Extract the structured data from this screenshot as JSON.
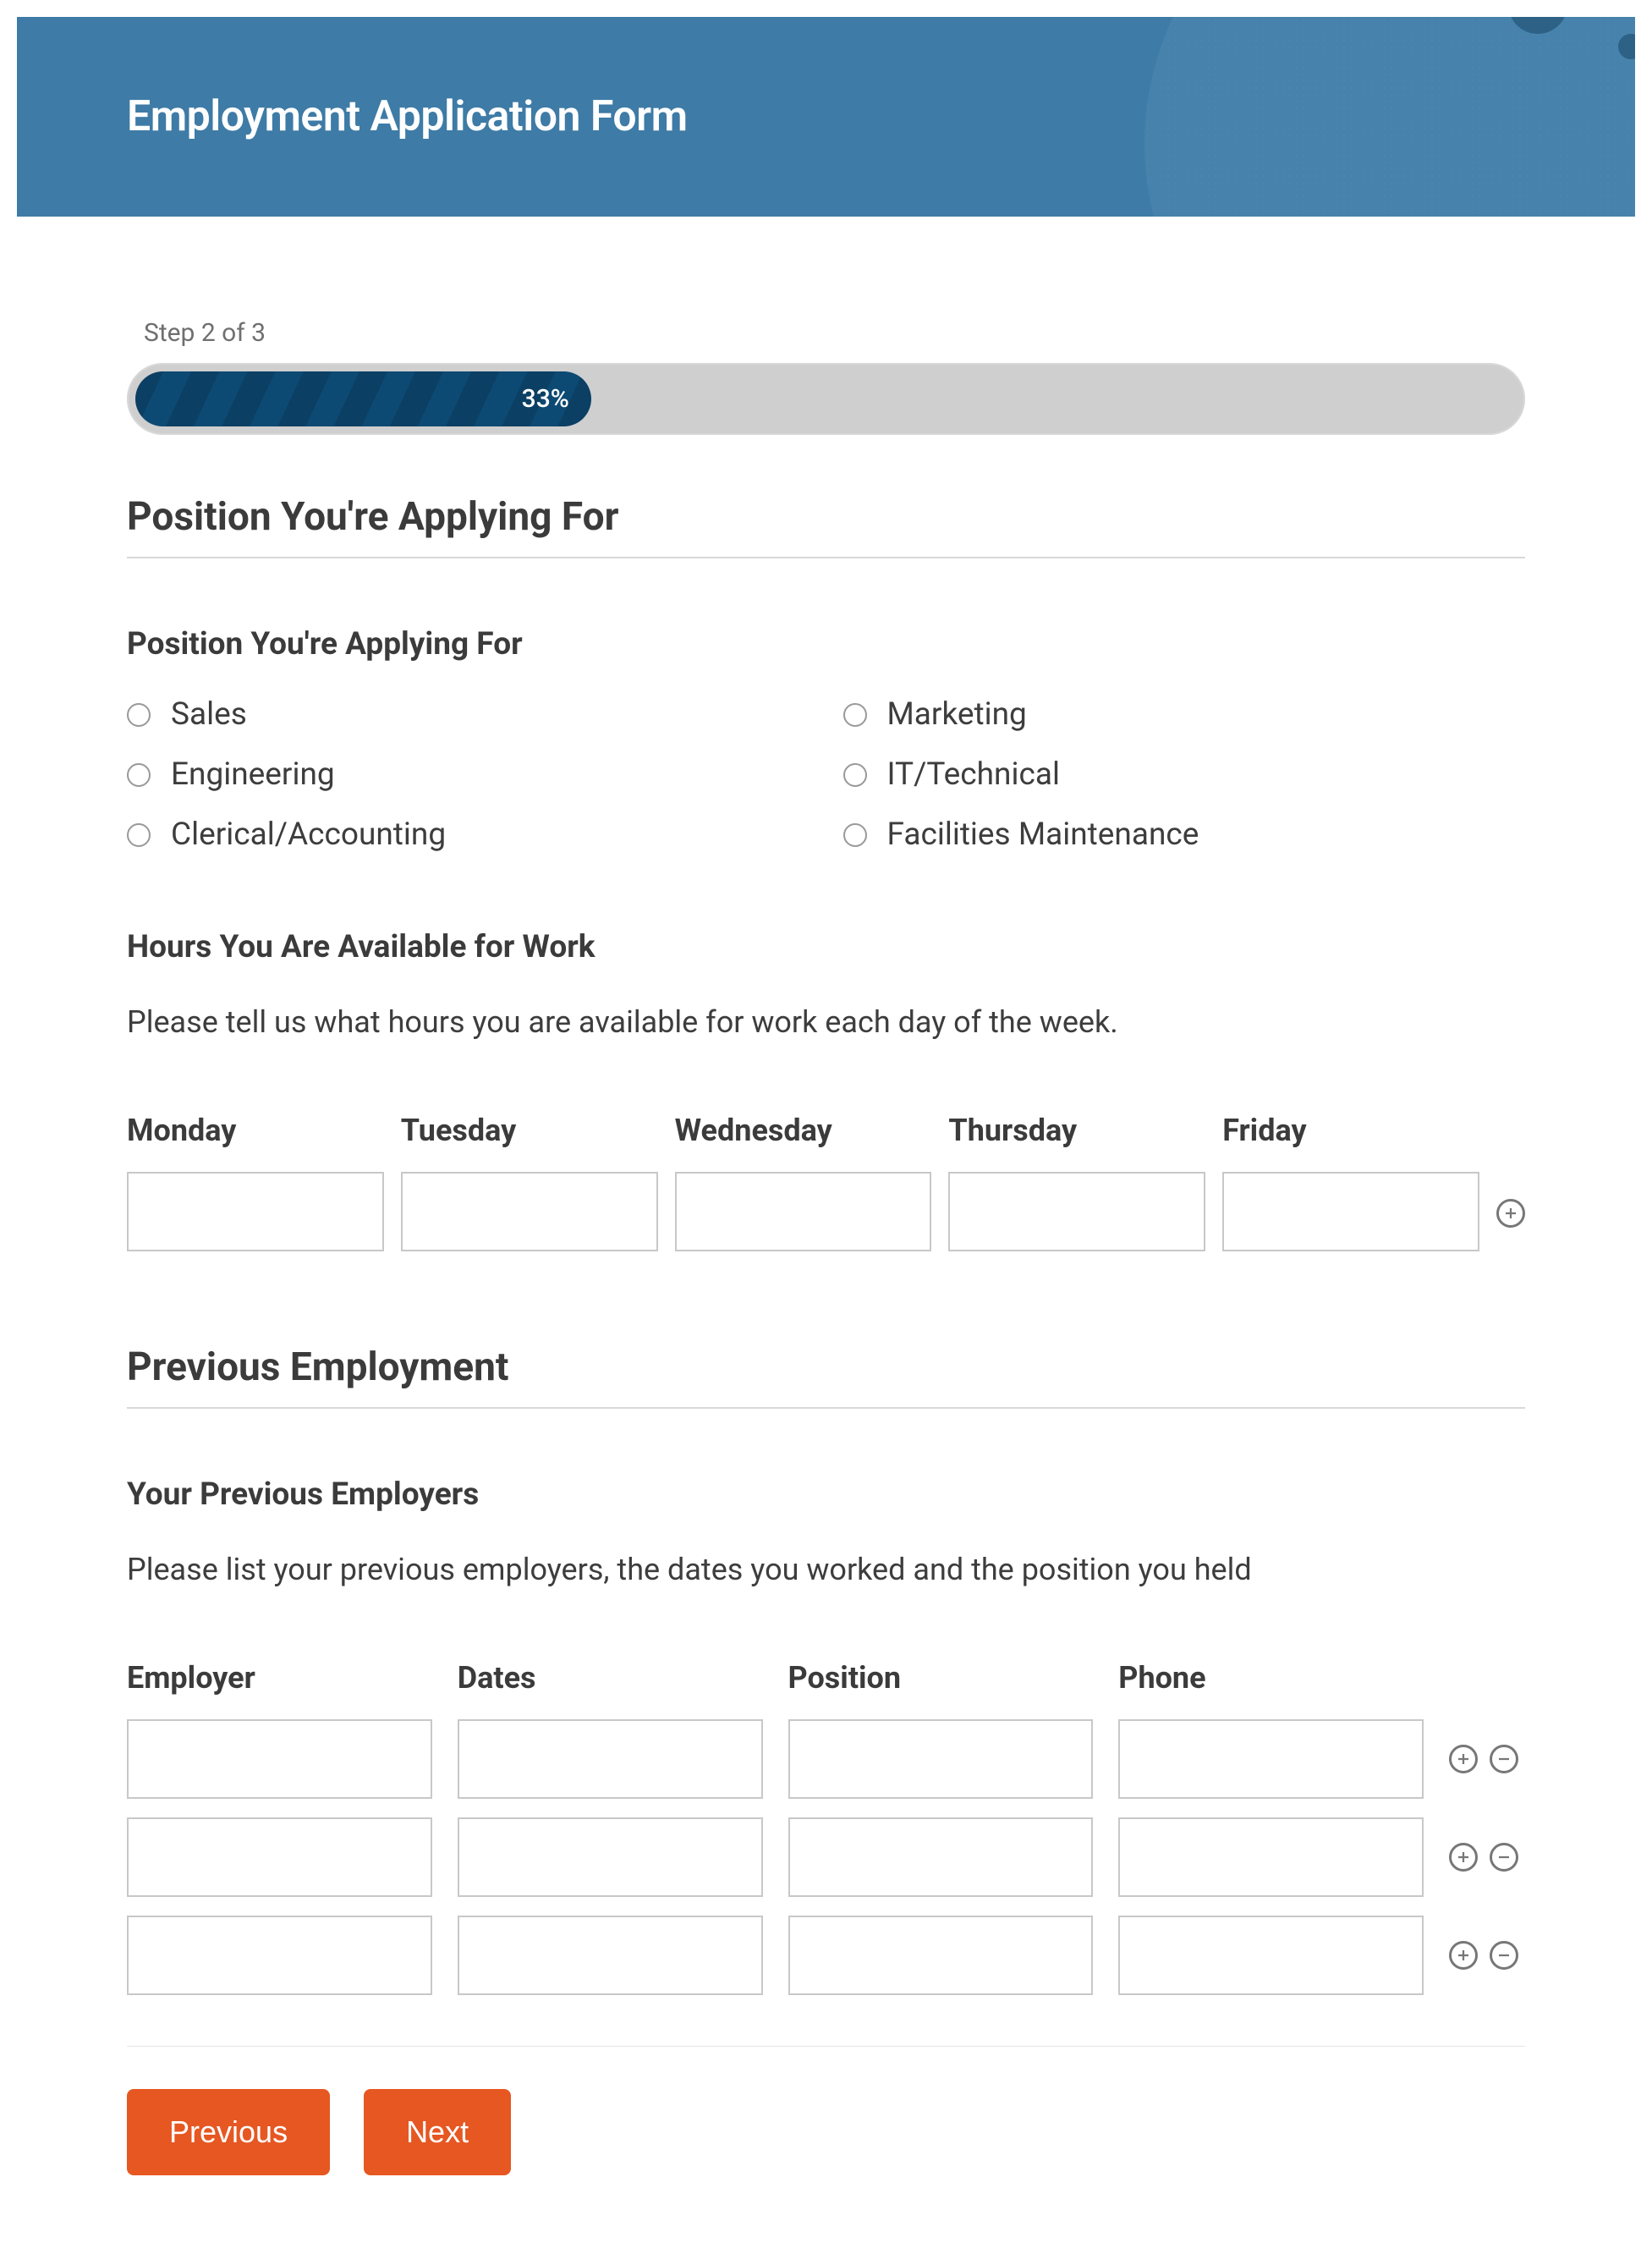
{
  "header": {
    "title": "Employment Application Form"
  },
  "progress": {
    "step_label": "Step 2 of 3",
    "percent_text": "33%",
    "percent": 33
  },
  "section_position": {
    "title": "Position You're Applying For",
    "field_label": "Position You're Applying For",
    "options": [
      "Sales",
      "Marketing",
      "Engineering",
      "IT/Technical",
      "Clerical/Accounting",
      "Facilities Maintenance"
    ]
  },
  "hours": {
    "label": "Hours You Are Available for Work",
    "description": "Please tell us what hours you are available for work each day of the week.",
    "columns": [
      "Monday",
      "Tuesday",
      "Wednesday",
      "Thursday",
      "Friday"
    ],
    "values": [
      "",
      "",
      "",
      "",
      ""
    ]
  },
  "section_previous": {
    "title": "Previous Employment",
    "employers_label": "Your Previous Employers",
    "description": "Please list your previous employers, the dates you worked and the position you held",
    "columns": [
      "Employer",
      "Dates",
      "Position",
      "Phone"
    ],
    "rows": [
      {
        "employer": "",
        "dates": "",
        "position": "",
        "phone": ""
      },
      {
        "employer": "",
        "dates": "",
        "position": "",
        "phone": ""
      },
      {
        "employer": "",
        "dates": "",
        "position": "",
        "phone": ""
      }
    ]
  },
  "buttons": {
    "previous": "Previous",
    "next": "Next"
  }
}
